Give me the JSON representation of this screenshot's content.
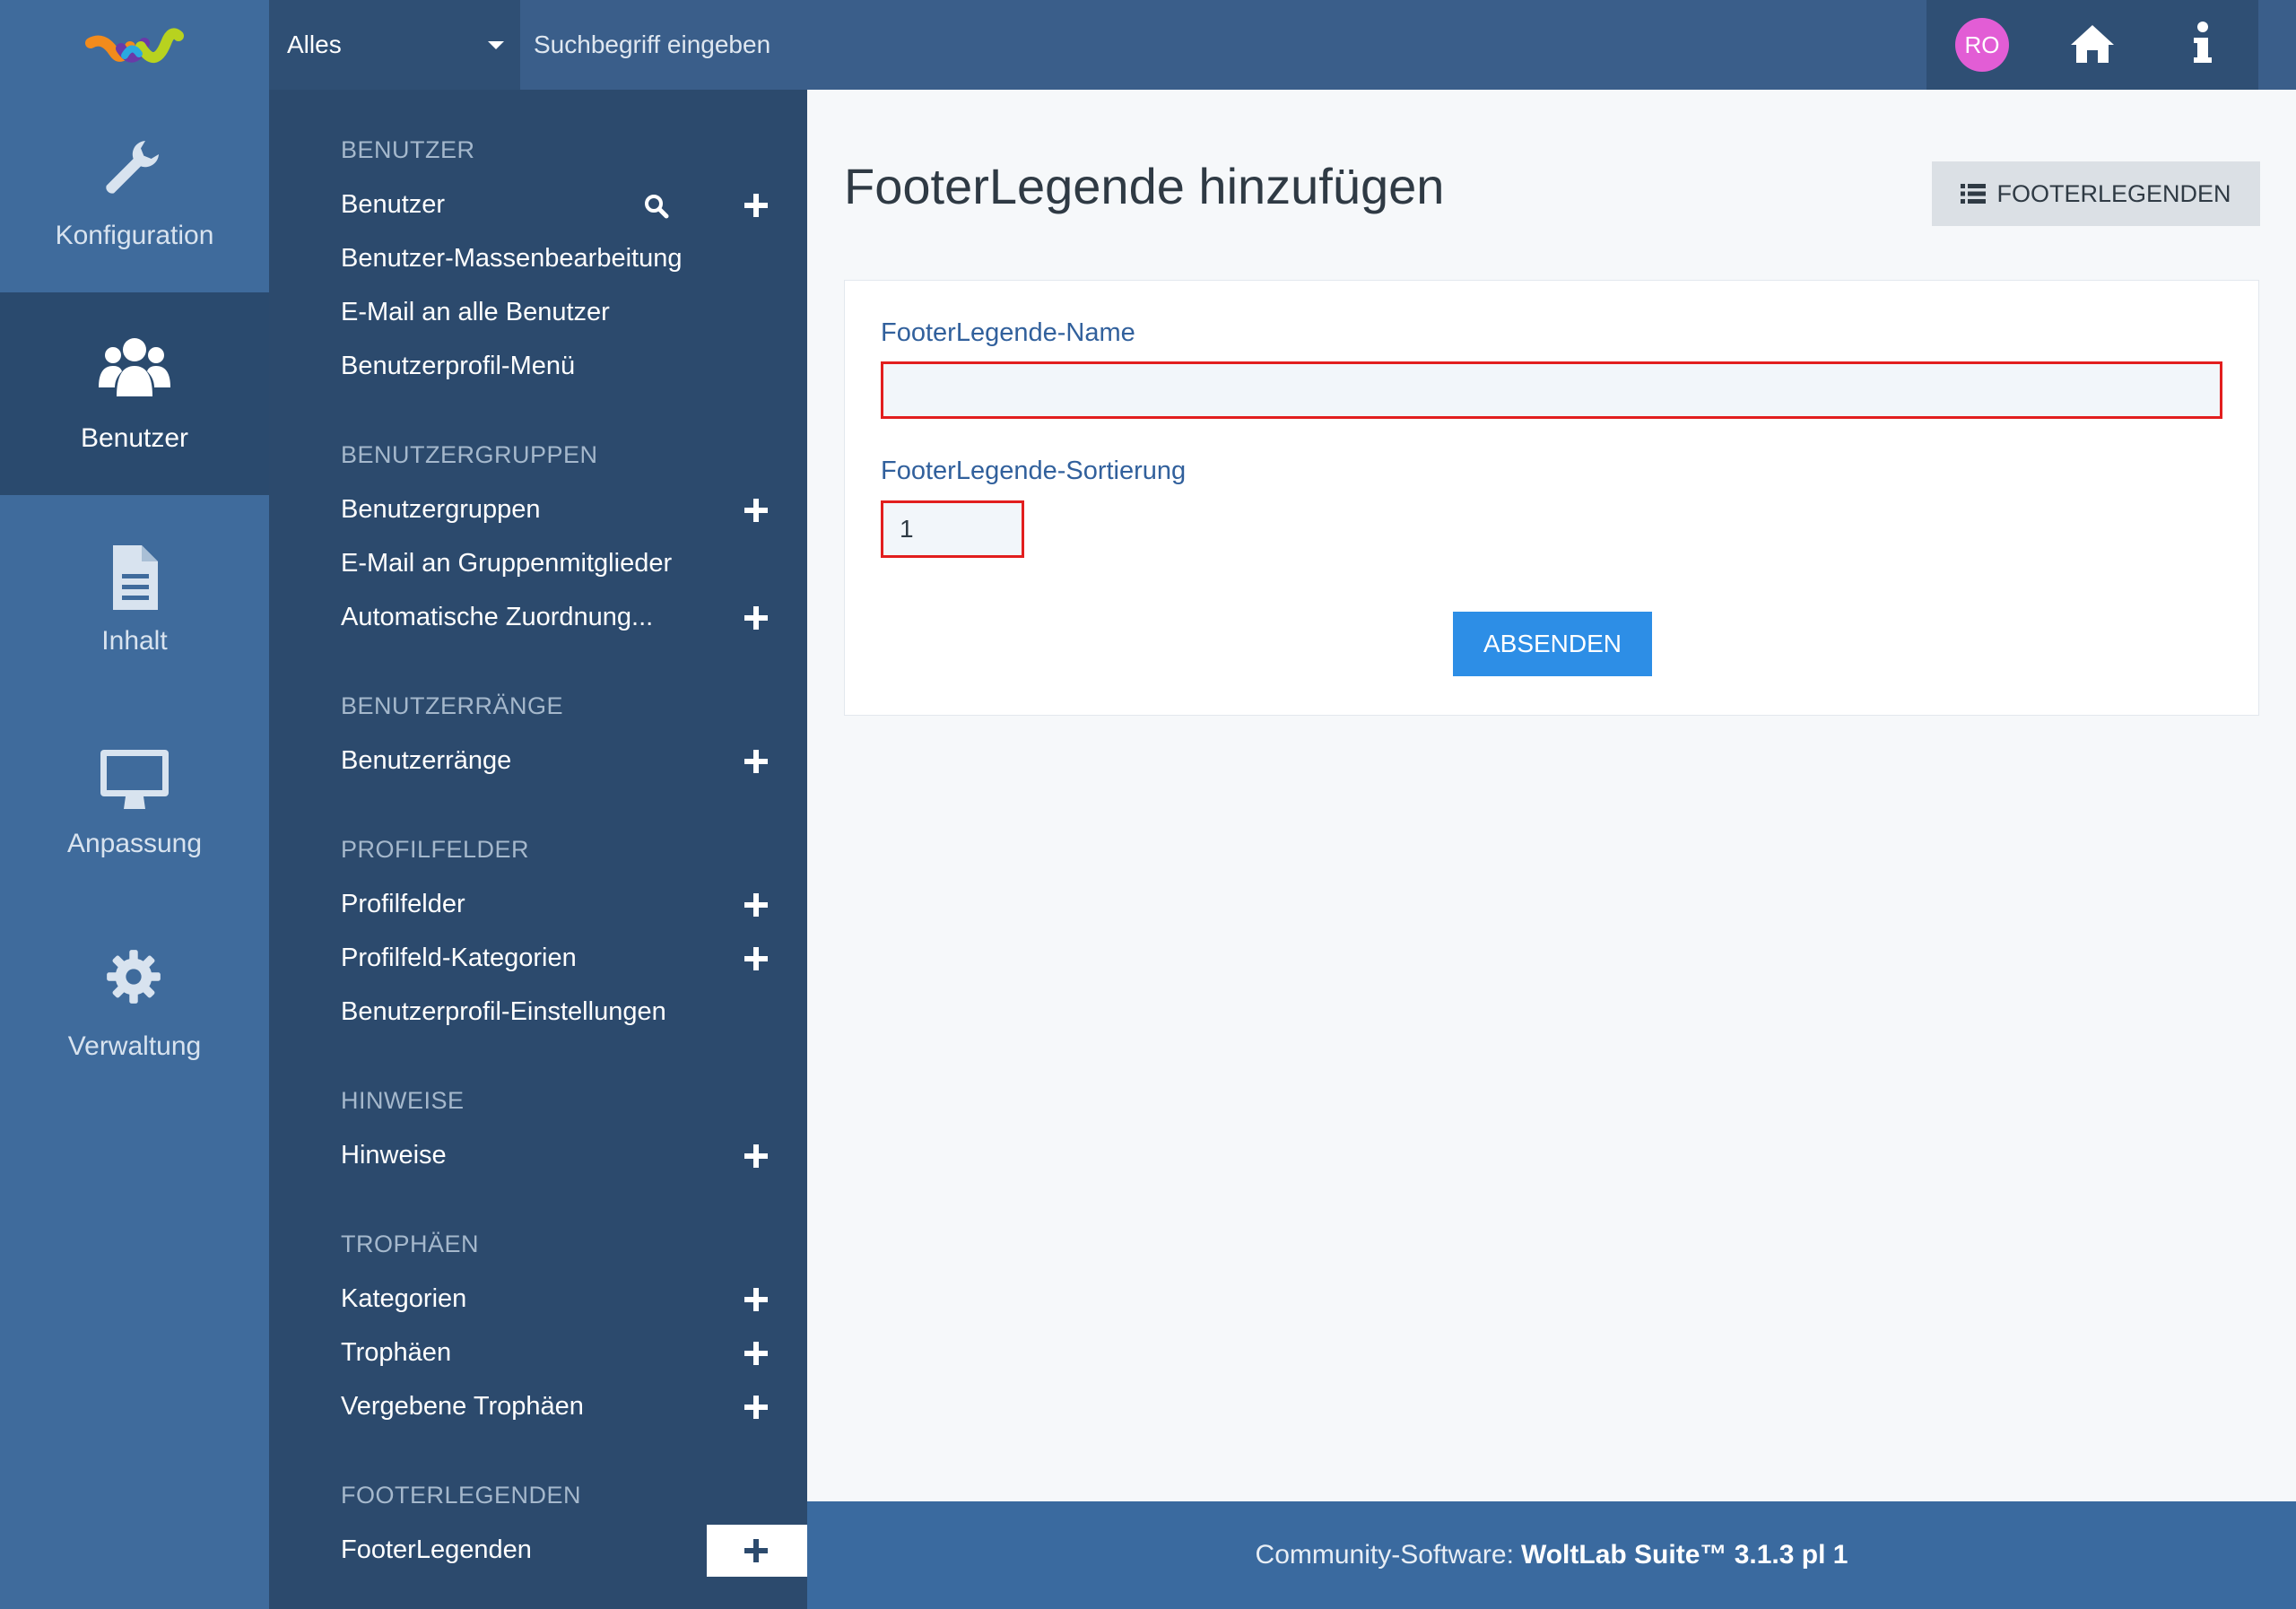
{
  "header": {
    "search_scope": "Alles",
    "search_placeholder": "Suchbegriff eingeben",
    "avatar_initials": "RO"
  },
  "main_nav": [
    {
      "label": "Konfiguration",
      "icon": "wrench-icon"
    },
    {
      "label": "Benutzer",
      "icon": "users-icon",
      "active": true
    },
    {
      "label": "Inhalt",
      "icon": "document-icon"
    },
    {
      "label": "Anpassung",
      "icon": "monitor-icon"
    },
    {
      "label": "Verwaltung",
      "icon": "gear-icon"
    }
  ],
  "submenu": {
    "sections": [
      {
        "title": "BENUTZER",
        "items": [
          "Benutzer",
          "Benutzer-Massenbearbeitung",
          "E-Mail an alle Benutzer",
          "Benutzerprofil-Menü"
        ]
      },
      {
        "title": "BENUTZERGRUPPEN",
        "items": [
          "Benutzergruppen",
          "E-Mail an Gruppenmitglieder",
          "Automatische Zuordnung..."
        ]
      },
      {
        "title": "BENUTZERRÄNGE",
        "items": [
          "Benutzerränge"
        ]
      },
      {
        "title": "PROFILFELDER",
        "items": [
          "Profilfelder",
          "Profilfeld-Kategorien",
          "Benutzerprofil-Einstellungen"
        ]
      },
      {
        "title": "HINWEISE",
        "items": [
          "Hinweise"
        ]
      },
      {
        "title": "TROPHÄEN",
        "items": [
          "Kategorien",
          "Trophäen",
          "Vergebene Trophäen"
        ]
      },
      {
        "title": "FOOTERLEGENDEN",
        "items": [
          "FooterLegenden"
        ]
      }
    ]
  },
  "page": {
    "title": "FooterLegende hinzufügen",
    "list_button": "FOOTERLEGENDEN",
    "name_label": "FooterLegende-Name",
    "name_value": "",
    "sort_label": "FooterLegende-Sortierung",
    "sort_value": "1",
    "submit_label": "ABSENDEN"
  },
  "footer": {
    "prefix": "Community-Software:",
    "product": "WoltLab Suite™ 3.1.3 pl 1"
  },
  "colors": {
    "topbar": "#3a5e8a",
    "sidebar": "#2c4a6d",
    "accent": "#2d8ee6",
    "error_border": "#e21e1e",
    "avatar": "#e25dd5"
  }
}
